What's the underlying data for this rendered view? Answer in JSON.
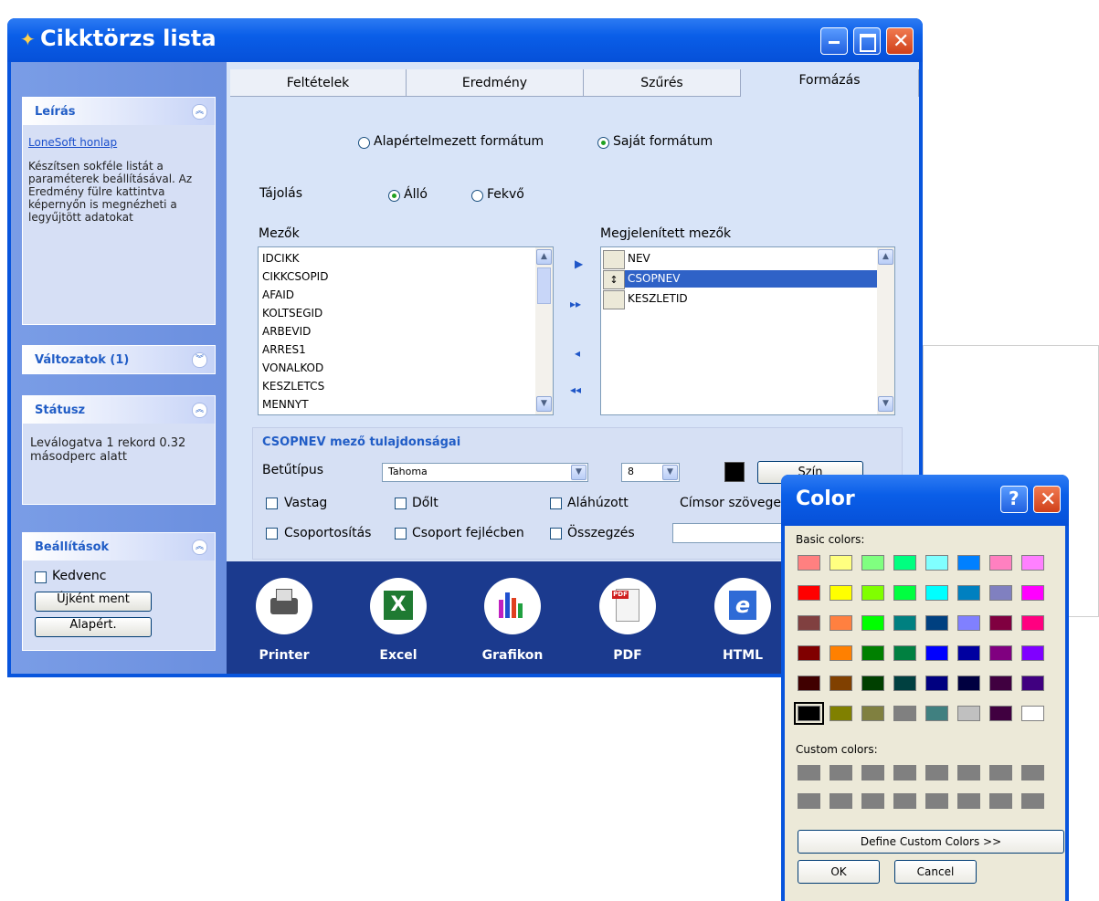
{
  "window": {
    "title": "Cikktörzs lista"
  },
  "sidebar": {
    "leiras": {
      "title": "Leírás",
      "link": "LoneSoft honlap",
      "text": "Készítsen sokféle listát a paraméterek beállításával. Az Eredmény fülre kattintva képernyőn is megnézheti a legyűjtött adatokat"
    },
    "valtozatok": {
      "title": "Változatok (1)"
    },
    "statusz": {
      "title": "Státusz",
      "text": "Leválogatva 1 rekord 0.32 másodperc alatt"
    },
    "beallitasok": {
      "title": "Beállítások",
      "kedvenc": "Kedvenc",
      "ujkent": "Újként ment",
      "alapert": "Alapért."
    }
  },
  "tabs": [
    "Feltételek",
    "Eredmény",
    "Szűrés",
    "Formázás"
  ],
  "format": {
    "default_label": "Alapértelmezett formátum",
    "own_label": "Saját formátum",
    "orientation_label": "Tájolás",
    "allo": "Álló",
    "fekvo": "Fekvő",
    "fields_label": "Mezők",
    "shown_label": "Megjelenített mezők",
    "fields": [
      "IDCIKK",
      "CIKKCSOPID",
      "AFAID",
      "KOLTSEGID",
      "ARBEVID",
      "ARRES1",
      "VONALKOD",
      "KESZLETCS",
      "MENNYT"
    ],
    "shown": [
      "NEV",
      "CSOPNEV",
      "KESZLETID"
    ]
  },
  "props": {
    "title": "CSOPNEV mező tulajdonságai",
    "font_label": "Betűtípus",
    "font_value": "Tahoma",
    "size_value": "8",
    "color_button": "Szín",
    "vastag": "Vastag",
    "dolt": "Dőlt",
    "alahuzott": "Aláhúzott",
    "cimsor": "Címsor szövege",
    "csoportositas": "Csoportosítás",
    "csoport_fejlec": "Csoport fejlécben",
    "osszegzes": "Összegzés"
  },
  "export": [
    "Printer",
    "Excel",
    "Grafikon",
    "PDF",
    "HTML"
  ],
  "color_dialog": {
    "title": "Color",
    "basic_label": "Basic colors:",
    "custom_label": "Custom colors:",
    "define": "Define Custom Colors >>",
    "ok": "OK",
    "cancel": "Cancel",
    "basic_colors": [
      "#ff8080",
      "#ffff80",
      "#80ff80",
      "#00ff80",
      "#80ffff",
      "#0080ff",
      "#ff80c0",
      "#ff80ff",
      "#ff0000",
      "#ffff00",
      "#80ff00",
      "#00ff40",
      "#00ffff",
      "#0080c0",
      "#8080c0",
      "#ff00ff",
      "#804040",
      "#ff8040",
      "#00ff00",
      "#008080",
      "#004080",
      "#8080ff",
      "#800040",
      "#ff0080",
      "#800000",
      "#ff8000",
      "#008000",
      "#008040",
      "#0000ff",
      "#0000a0",
      "#800080",
      "#8000ff",
      "#400000",
      "#804000",
      "#004000",
      "#004040",
      "#000080",
      "#000040",
      "#400040",
      "#400080",
      "#000000",
      "#808000",
      "#808040",
      "#808080",
      "#408080",
      "#c0c0c0",
      "#400040",
      "#ffffff"
    ],
    "custom_color": "#808080"
  }
}
